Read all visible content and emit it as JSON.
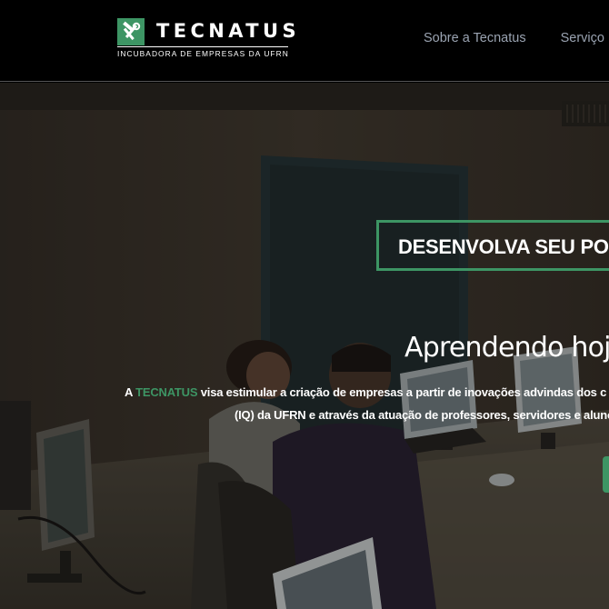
{
  "brand": {
    "name": "TECNATUS",
    "tagline": "INCUBADORA DE EMPRESAS DA UFRN",
    "accent_color": "#3d9564",
    "logo_icon": "tools-icon"
  },
  "nav": {
    "items": [
      {
        "label": "Sobre a Tecnatus"
      },
      {
        "label": "Serviço"
      }
    ]
  },
  "hero": {
    "title": "DESENVOLVA SEU PO",
    "subtitle": "Aprendendo hoje",
    "paragraph_line1_prefix": "A ",
    "paragraph_line1_highlight": "TECNATUS",
    "paragraph_line1_rest": " visa estimular a criação de empresas a partir de inovações advindas dos c",
    "paragraph_line2": "(IQ) da UFRN e através da atuação de professores, servidores e alunos",
    "background": "photo-of-computer-lab"
  }
}
